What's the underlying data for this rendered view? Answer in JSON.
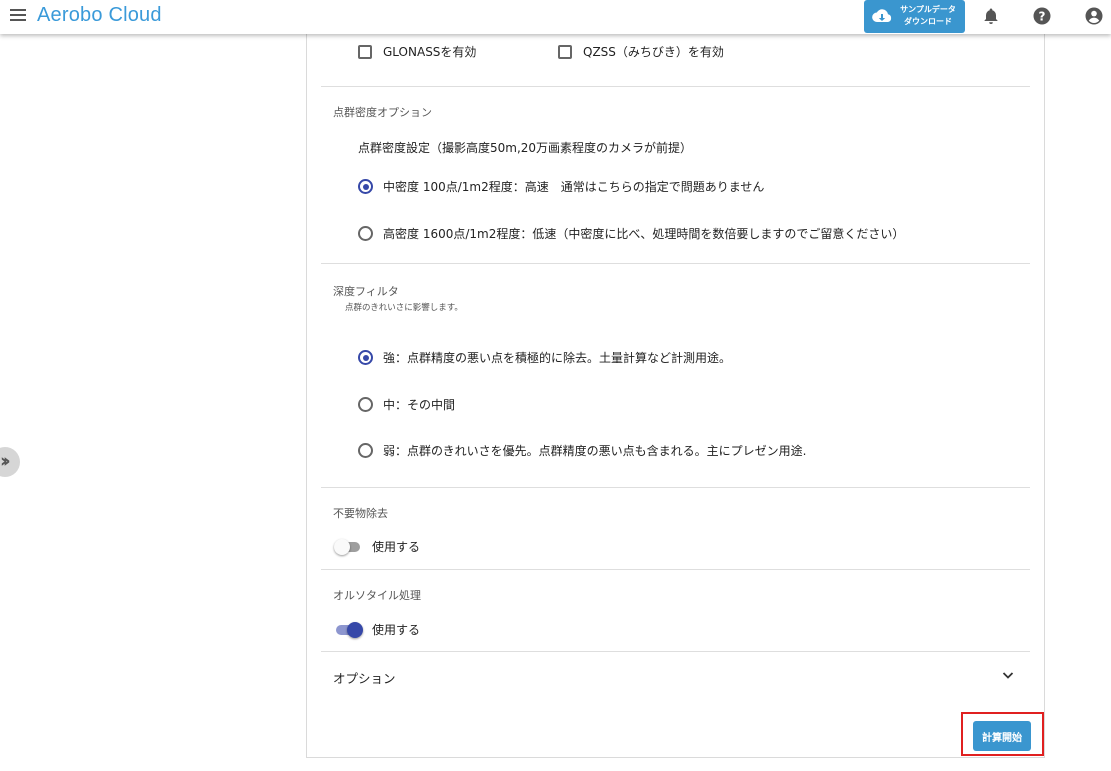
{
  "app": {
    "title": "Aerobo Cloud",
    "download_label_line1": "サンプルデータ",
    "download_label_line2": "ダウンロード"
  },
  "gnss": {
    "glonass_label": "GLONASSを有効",
    "glonass_checked": false,
    "qzss_label": "QZSS（みちびき）を有効",
    "qzss_checked": false
  },
  "density": {
    "title": "点群密度オプション",
    "setting_label": "点群密度設定（撮影高度50m,20万画素程度のカメラが前提）",
    "options": [
      {
        "label": "中密度 100点/1m2程度：高速　通常はこちらの指定で問題ありません",
        "selected": true
      },
      {
        "label": "高密度 1600点/1m2程度：低速（中密度に比べ、処理時間を数倍要しますのでご留意ください）",
        "selected": false
      }
    ]
  },
  "depth_filter": {
    "title": "深度フィルタ",
    "subtitle": "点群のきれいさに影響します。",
    "options": [
      {
        "label": "強：点群精度の悪い点を積極的に除去。土量計算など計測用途。",
        "selected": true
      },
      {
        "label": "中：その中間",
        "selected": false
      },
      {
        "label": "弱：点群のきれいさを優先。点群精度の悪い点も含まれる。主にプレゼン用途.",
        "selected": false
      }
    ]
  },
  "unwanted_removal": {
    "title": "不要物除去",
    "toggle_label": "使用する",
    "enabled": false
  },
  "ortho_tile": {
    "title": "オルソタイル処理",
    "toggle_label": "使用する",
    "enabled": true
  },
  "options_section": {
    "label": "オプション"
  },
  "actions": {
    "start_label": "計算開始"
  },
  "colors": {
    "accent_blue": "#3a96cf",
    "radio_selected": "#3648a8",
    "highlight_border": "#e02020"
  }
}
